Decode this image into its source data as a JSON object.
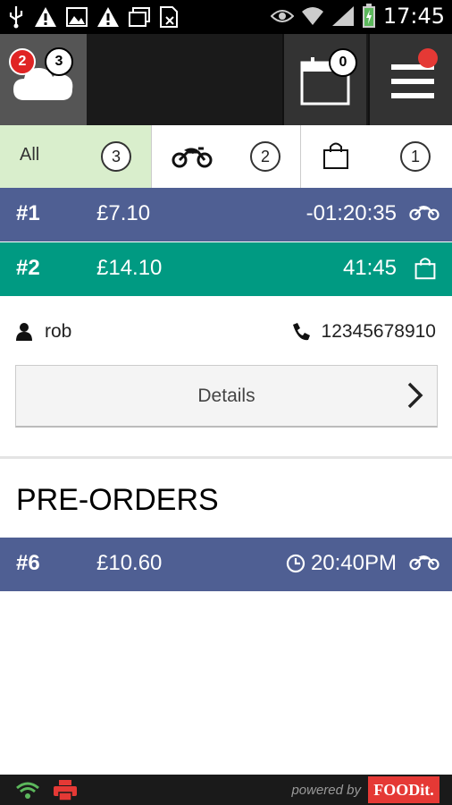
{
  "status_bar": {
    "time": "17:45",
    "left_icons": [
      "usb-icon",
      "warning-icon",
      "image-icon",
      "warning-icon",
      "window-icon",
      "file-icon"
    ],
    "right_icons": [
      "eye-icon",
      "wifi-icon",
      "signal-icon",
      "battery-icon"
    ]
  },
  "header": {
    "cloud_badge_red": "2",
    "cloud_badge_white": "3",
    "calendar_badge": "0",
    "colors": {
      "bar": "#1a1a1a",
      "badge_red": "#e02424",
      "notify_dot": "#e53935"
    }
  },
  "filters": [
    {
      "label": "All",
      "count": "3",
      "icon": "",
      "active": true
    },
    {
      "label": "",
      "count": "2",
      "icon": "motorbike-icon",
      "active": false
    },
    {
      "label": "",
      "count": "1",
      "icon": "shopping-bag-icon",
      "active": false
    }
  ],
  "orders": [
    {
      "num": "#1",
      "price": "£7.10",
      "time": "-01:20:35",
      "type": "delivery",
      "icon": "motorbike-icon"
    },
    {
      "num": "#2",
      "price": "£14.10",
      "time": "41:45",
      "type": "collection",
      "icon": "shopping-bag-icon"
    }
  ],
  "expanded": {
    "customer": "rob",
    "phone": "12345678910",
    "details_label": "Details"
  },
  "preorders": {
    "title": "PRE-ORDERS",
    "items": [
      {
        "num": "#6",
        "price": "£10.60",
        "time": "20:40PM",
        "type": "delivery",
        "icon": "motorbike-icon"
      }
    ]
  },
  "footer": {
    "powered_by": "powered by",
    "brand": "FOODit.",
    "left_icons": [
      "wifi-icon",
      "printer-icon"
    ]
  },
  "colors": {
    "delivery": "#4f5f93",
    "collection": "#009a82",
    "active_tab": "#d9eecc"
  }
}
